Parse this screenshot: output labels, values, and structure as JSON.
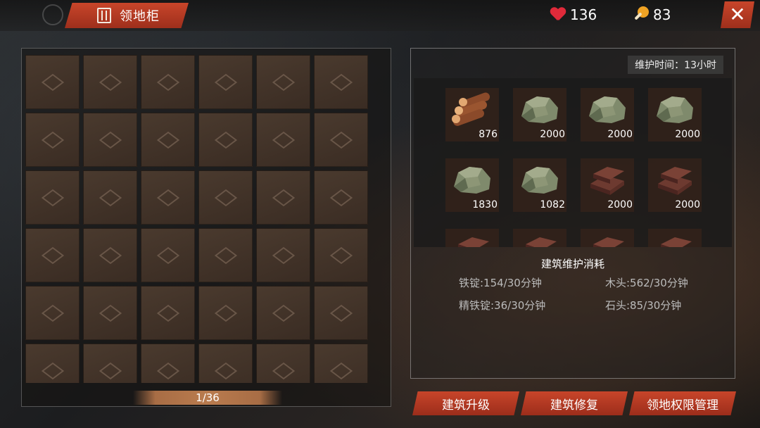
{
  "header": {
    "title": "领地柜",
    "health": "136",
    "food": "83",
    "close_label": "✕"
  },
  "inventory": {
    "capacity_text": "1/36",
    "visible_slots": 36
  },
  "maintenance": {
    "time_label": "维护时间：13小时",
    "resources": [
      {
        "name": "wood-logs",
        "qty": "876"
      },
      {
        "name": "stone",
        "qty": "2000"
      },
      {
        "name": "stone",
        "qty": "2000"
      },
      {
        "name": "stone",
        "qty": "2000"
      },
      {
        "name": "stone",
        "qty": "1830"
      },
      {
        "name": "stone",
        "qty": "1082"
      },
      {
        "name": "iron-ingot",
        "qty": "2000"
      },
      {
        "name": "iron-ingot",
        "qty": "2000"
      },
      {
        "name": "iron-ingot",
        "qty": ""
      },
      {
        "name": "iron-ingot",
        "qty": ""
      },
      {
        "name": "iron-ingot",
        "qty": ""
      },
      {
        "name": "iron-ingot",
        "qty": ""
      }
    ],
    "section_title": "建筑维护消耗",
    "costs": {
      "iron": "铁锭:154/30分钟",
      "wood": "木头:562/30分钟",
      "refined_iron": "精铁锭:36/30分钟",
      "stone": "石头:85/30分钟"
    }
  },
  "actions": {
    "upgrade": "建筑升级",
    "repair": "建筑修复",
    "permissions": "领地权限管理"
  },
  "colors": {
    "accent": "#c8452a",
    "heart": "#e02a3a",
    "food": "#f0a324"
  }
}
